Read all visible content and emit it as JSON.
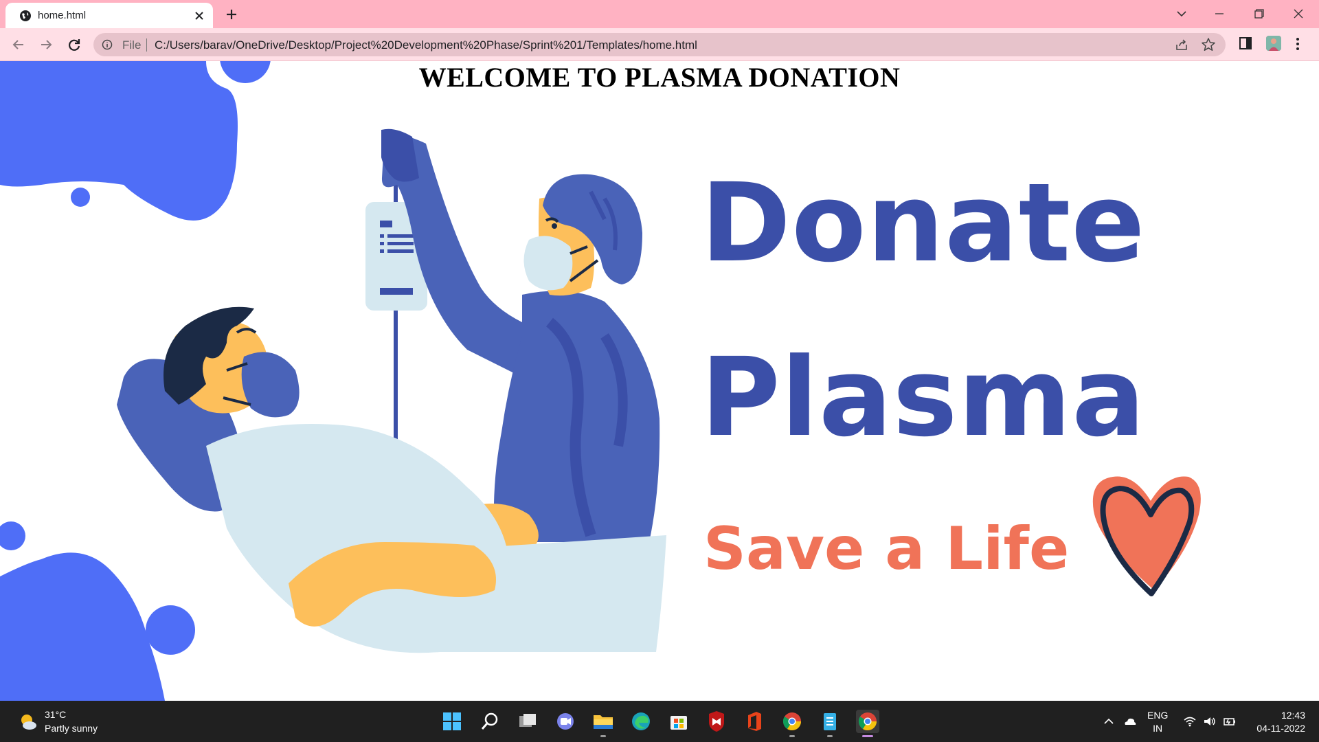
{
  "browser": {
    "tab_title": "home.html",
    "scheme_label": "File",
    "url": "C:/Users/barav/OneDrive/Desktop/Project%20Development%20Phase/Sprint%201/Templates/home.html"
  },
  "page": {
    "heading": "WELCOME TO PLASMA DONATION",
    "hero": {
      "line1": "Donate",
      "line2": "Plasma",
      "tagline": "Save a Life"
    },
    "colors": {
      "blob_blue": "#4f6ef7",
      "navy_text": "#3b4fa8",
      "coral": "#f07358",
      "scrubs_blue": "#4a63b8",
      "skin": "#fdbf5b",
      "light_blue": "#d5e8f0"
    }
  },
  "taskbar": {
    "weather_temp": "31°C",
    "weather_desc": "Partly sunny",
    "apps": [
      "start",
      "search",
      "task-view",
      "teams-chat",
      "file-explorer",
      "edge",
      "store",
      "mcafee",
      "office",
      "chrome",
      "notepad",
      "chrome-active"
    ],
    "language_line1": "ENG",
    "language_line2": "IN",
    "time": "12:43",
    "date": "04-11-2022"
  }
}
